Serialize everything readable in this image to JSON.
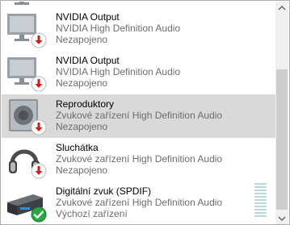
{
  "devices": [
    {
      "name": "NVIDIA Output",
      "description": "NVIDIA High Definition Audio",
      "status": "Nezapojeno",
      "icon": "monitor-icon",
      "status_icon": "disconnected-arrow-icon",
      "selected": false
    },
    {
      "name": "NVIDIA Output",
      "description": "NVIDIA High Definition Audio",
      "status": "Nezapojeno",
      "icon": "monitor-icon",
      "status_icon": "disconnected-arrow-icon",
      "selected": false
    },
    {
      "name": "Reproduktory",
      "description": "Zvukové zařízení High Definition Audio",
      "status": "Nezapojeno",
      "icon": "speaker-icon",
      "status_icon": "disconnected-arrow-icon",
      "selected": true
    },
    {
      "name": "Sluchátka",
      "description": "Zvukové zařízení High Definition Audio",
      "status": "Nezapojeno",
      "icon": "headphones-icon",
      "status_icon": "disconnected-arrow-icon",
      "selected": false
    },
    {
      "name": "Digitální zvuk (SPDIF)",
      "description": "Zvukové zařízení High Definition Audio",
      "status": "Výchozí zařízení",
      "icon": "digital-audio-receiver-icon",
      "status_icon": "default-checkmark-icon",
      "selected": false
    }
  ],
  "colors": {
    "selected_row": "#d9d9d9",
    "disconnected_badge": "#d21b1b",
    "default_badge": "#28a745",
    "secondary_text": "#6d6d6d",
    "level_meter": "#b9d6e6"
  },
  "level_meter": {
    "level": 0
  }
}
